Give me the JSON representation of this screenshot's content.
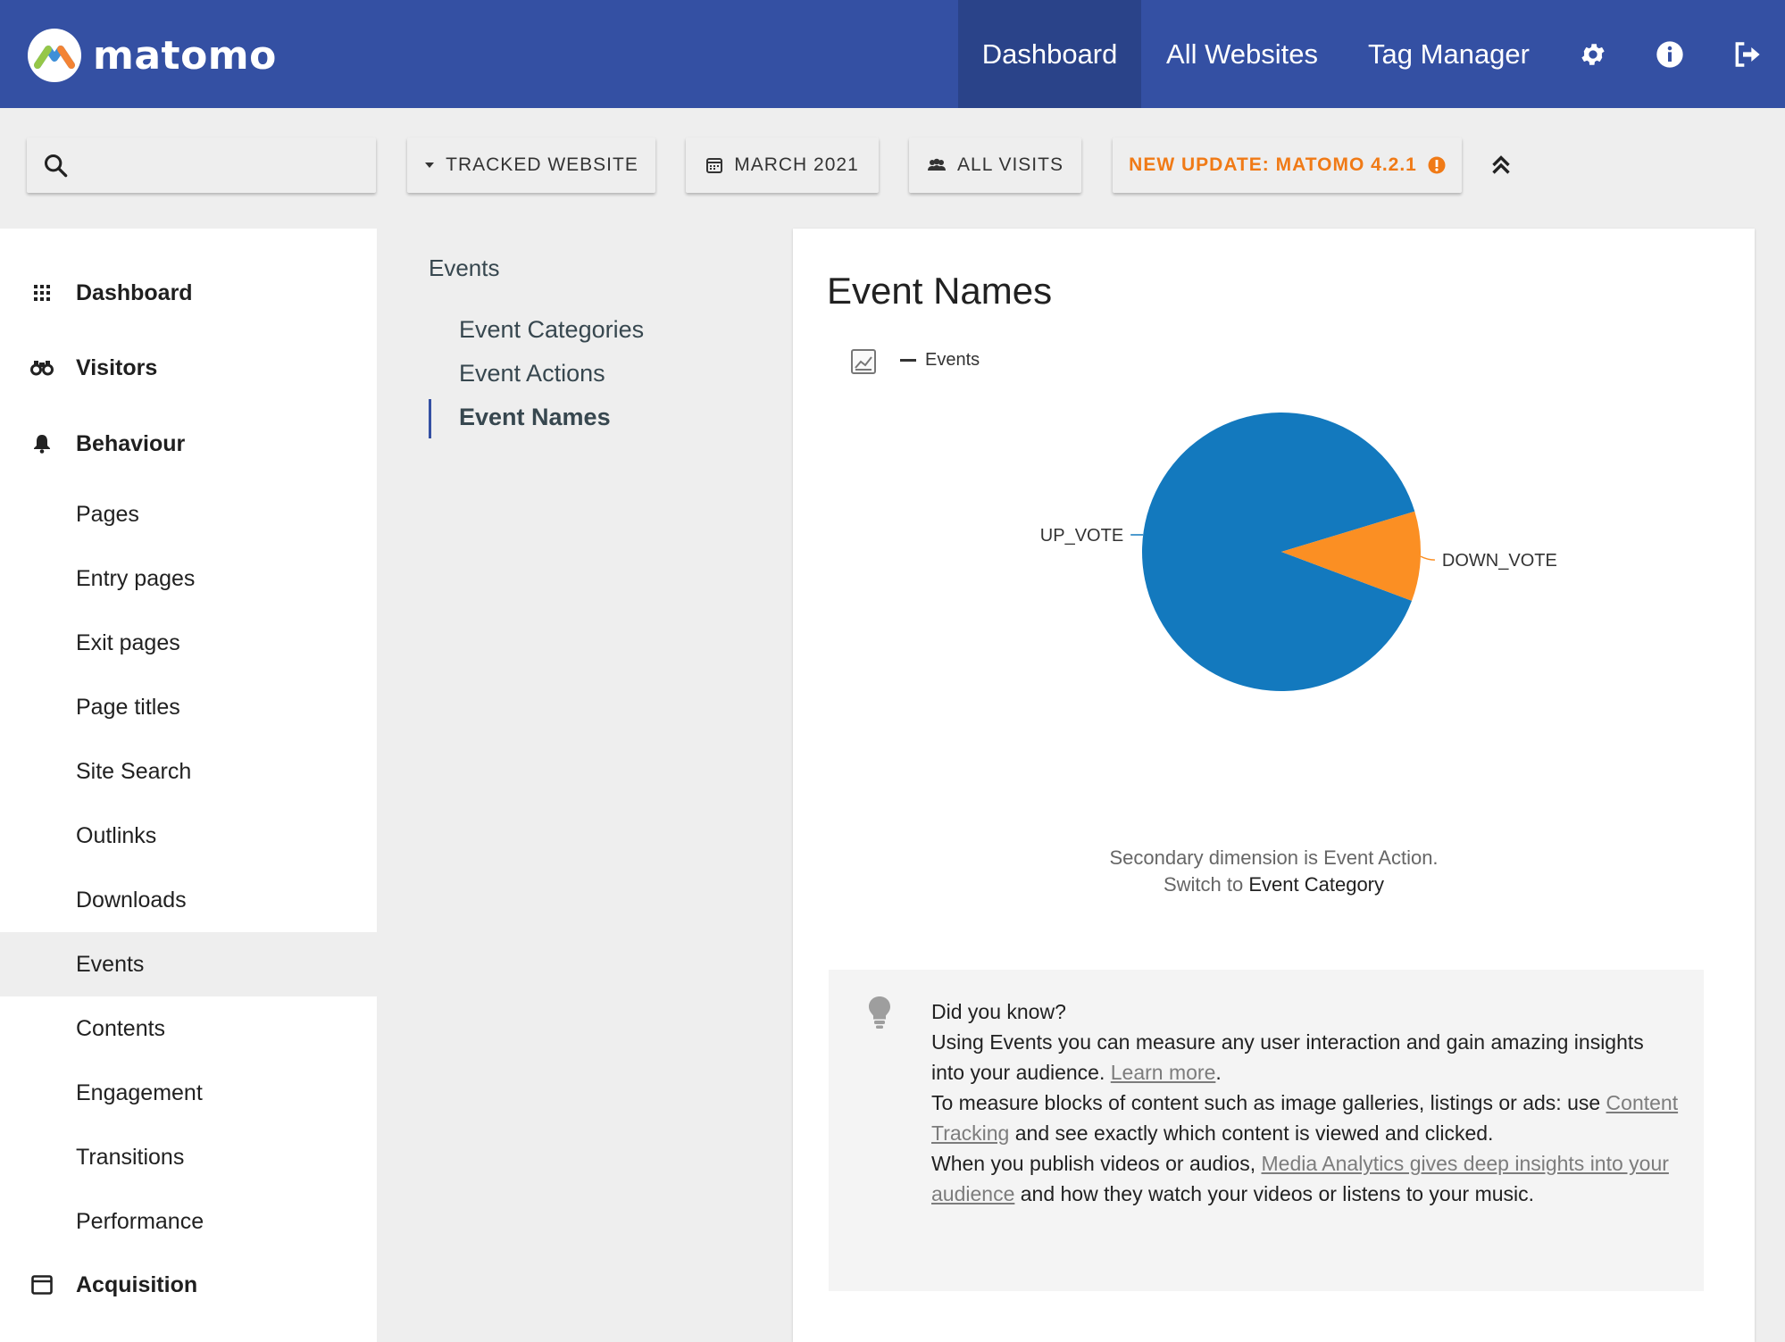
{
  "brand": {
    "name": "matomo",
    "accent": "#3450a3"
  },
  "topnav": {
    "items": [
      {
        "label": "Dashboard",
        "active": true
      },
      {
        "label": "All Websites"
      },
      {
        "label": "Tag Manager"
      }
    ],
    "icons": [
      "gear-icon",
      "info-icon",
      "logout-icon"
    ]
  },
  "toolbar": {
    "search": {
      "placeholder": "",
      "value": ""
    },
    "site_selector": "TRACKED WEBSITE",
    "period": "MARCH 2021",
    "segment": "ALL VISITS",
    "update_notice": "NEW UPDATE: MATOMO 4.2.1"
  },
  "sidebar": {
    "sections": [
      {
        "label": "Dashboard",
        "icon": "grid-icon"
      },
      {
        "label": "Visitors",
        "icon": "binoculars-icon"
      },
      {
        "label": "Behaviour",
        "icon": "bell-icon"
      },
      {
        "label": "Acquisition",
        "icon": "window-icon"
      }
    ],
    "behaviour_items": [
      "Pages",
      "Entry pages",
      "Exit pages",
      "Page titles",
      "Site Search",
      "Outlinks",
      "Downloads",
      "Events",
      "Contents",
      "Engagement",
      "Transitions",
      "Performance"
    ],
    "active_item": "Events"
  },
  "submenu": {
    "title": "Events",
    "items": [
      "Event Categories",
      "Event Actions",
      "Event Names"
    ],
    "active": "Event Names"
  },
  "widget": {
    "title": "Event Names",
    "legend": "Events",
    "footnote_line1": "Secondary dimension is Event Action.",
    "footnote_switch": "Switch to",
    "footnote_link": "Event Category"
  },
  "chart_data": {
    "type": "pie",
    "series": [
      {
        "name": "Events",
        "values": [
          0.896,
          0.104
        ]
      }
    ],
    "categories": [
      "UP_VOTE",
      "DOWN_VOTE"
    ],
    "colors": [
      "#1379be",
      "#fb8f23"
    ]
  },
  "tip": {
    "heading": "Did you know?",
    "p1a": "Using Events you can measure any user interaction and gain amazing insights into your audience.",
    "p1_link": "Learn more",
    "p1b": ".",
    "p2a": "To measure blocks of content such as image galleries, listings or ads: use",
    "p2_link": "Content Tracking",
    "p2b": "and see exactly which content is viewed and clicked.",
    "p3a": "When you publish videos or audios,",
    "p3_link": "Media Analytics gives deep insights into your audience",
    "p3b": "and how they watch your videos or listens to your music."
  }
}
